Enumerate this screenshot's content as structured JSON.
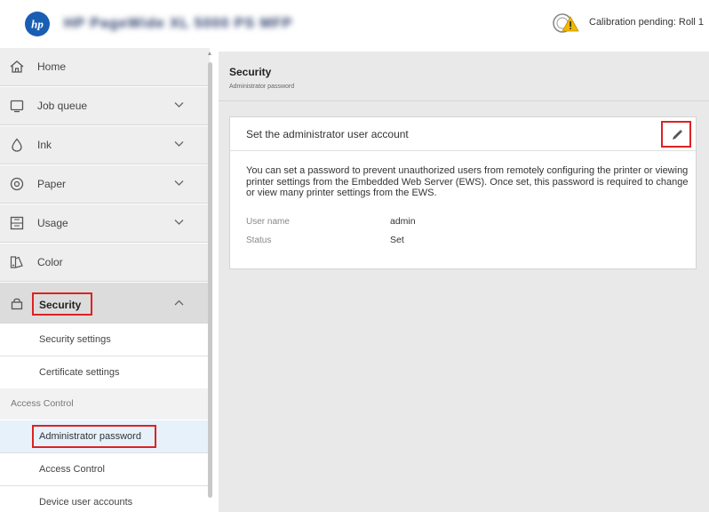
{
  "header": {
    "printer_name": "HP PageWide XL 5000 PS MFP",
    "status_text": "Calibration pending: Roll 1"
  },
  "sidebar": {
    "items": [
      {
        "label": "Home",
        "icon": "home-icon"
      },
      {
        "label": "Job queue",
        "icon": "job-queue-icon"
      },
      {
        "label": "Ink",
        "icon": "ink-drop-icon"
      },
      {
        "label": "Paper",
        "icon": "paper-roll-icon"
      },
      {
        "label": "Usage",
        "icon": "usage-icon"
      },
      {
        "label": "Color",
        "icon": "color-icon"
      },
      {
        "label": "Security",
        "icon": "lock-icon"
      }
    ],
    "security_sub": [
      {
        "label": "Security settings"
      },
      {
        "label": "Certificate settings"
      }
    ],
    "access_section_label": "Access Control",
    "access_sub": [
      {
        "label": "Administrator password"
      },
      {
        "label": "Access Control"
      },
      {
        "label": "Device user accounts"
      }
    ]
  },
  "content": {
    "title": "Security",
    "subtitle": "Administrator password",
    "card": {
      "title": "Set the administrator user account",
      "description": "You can set a password to prevent unauthorized users from remotely configuring the printer or viewing printer settings from the Embedded Web Server (EWS). Once set, this password is required to change or view many printer settings from the EWS.",
      "fields": [
        {
          "label": "User name",
          "value": "admin"
        },
        {
          "label": "Status",
          "value": "Set"
        }
      ]
    }
  },
  "colors": {
    "hp_blue": "#1a5eb3",
    "highlight_red": "#dd2222",
    "selected_bg": "#e6f1fa"
  }
}
